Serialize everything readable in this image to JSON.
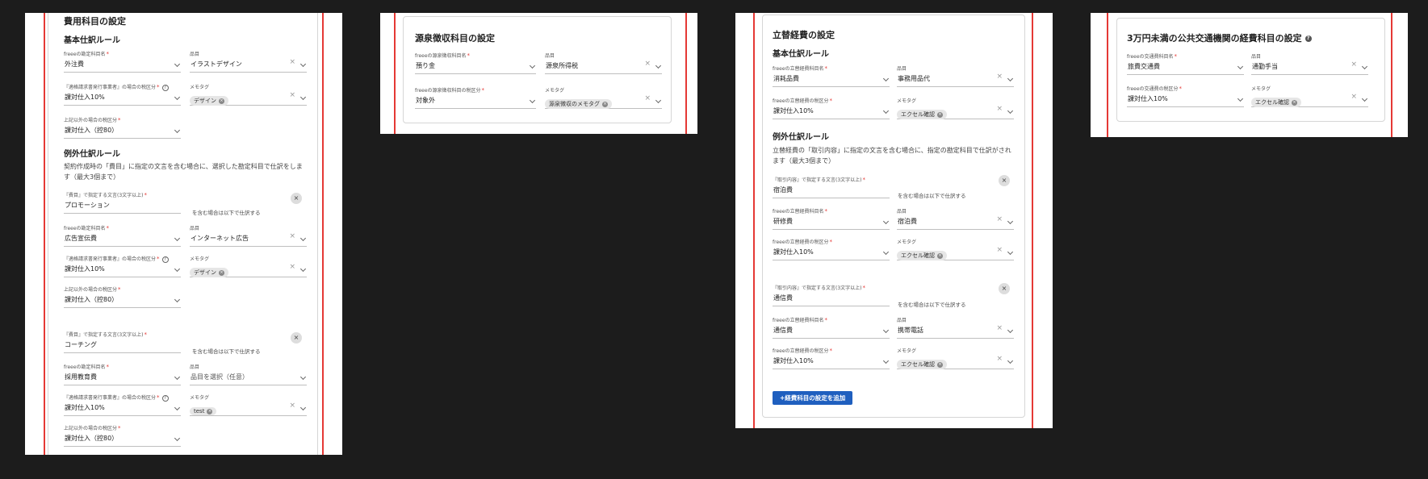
{
  "common": {
    "required_mark": "*",
    "help_mark": "?",
    "clear_mark": "×",
    "tag_remove_mark": "×",
    "remove_mark": "×"
  },
  "p1": {
    "title": "費用科目の設定",
    "basic_title": "基本仕訳ルール",
    "f_account_label": "freeeの勘定科目名",
    "f_account_value": "外注費",
    "f_item_label": "品目",
    "f_item_value": "イラストデザイン",
    "f_tax_label": "『適格請求書発行事業者』の場合の税区分",
    "f_tax_value": "課対仕入10%",
    "f_memo_label": "メモタグ",
    "f_memo_tag": "デザイン",
    "f_other_label": "上記以外の場合の税区分",
    "f_other_value": "課対仕入（控80）",
    "exc_title": "例外仕訳ルール",
    "exc_desc": "契約作成時の「費目」に指定の文言を含む場合に、選択した勘定科目で仕訳をします（最大3個まで）",
    "r1_text_label": "『費目』で指定する文言(3文字以上)",
    "r1_text_value": "プロモーション",
    "r1_note": "を含む場合は以下で仕訳する",
    "r1_account_label": "freeeの勘定科目名",
    "r1_account_value": "広告宣伝費",
    "r1_item_label": "品目",
    "r1_item_value": "インターネット広告",
    "r1_tax_label": "『適格請求書発行事業者』の場合の税区分",
    "r1_tax_value": "課対仕入10%",
    "r1_memo_label": "メモタグ",
    "r1_memo_tag": "デザイン",
    "r1_other_label": "上記以外の場合の税区分",
    "r1_other_value": "課対仕入（控80）",
    "r2_text_label": "『費目』で指定する文言(3文字以上)",
    "r2_text_value": "コーチング",
    "r2_note": "を含む場合は以下で仕訳する",
    "r2_account_label": "freeeの勘定科目名",
    "r2_account_value": "採用教育費",
    "r2_item_label": "品目",
    "r2_item_placeholder": "品目を選択（任意）",
    "r2_tax_label": "『適格請求書発行事業者』の場合の税区分",
    "r2_tax_value": "課対仕入10%",
    "r2_memo_label": "メモタグ",
    "r2_memo_tag": "test",
    "r2_other_label": "上記以外の場合の税区分",
    "r2_other_value": "課対仕入（控80）"
  },
  "p2": {
    "title": "源泉徴収科目の設定",
    "f_account_label": "freeeの源泉徴収科目名",
    "f_account_value": "預り金",
    "f_item_label": "品目",
    "f_item_value": "源泉所得税",
    "f_tax_label": "freeeの源泉徴収科目の税区分",
    "f_tax_value": "対象外",
    "f_memo_label": "メモタグ",
    "f_memo_tag": "源泉徴収のメモタグ"
  },
  "p3": {
    "title": "立替経費の設定",
    "basic_title": "基本仕訳ルール",
    "f_account_label": "freeeの立替経費科目名",
    "f_account_value": "消耗品費",
    "f_item_label": "品目",
    "f_item_value": "事務用品代",
    "f_tax_label": "freeeの立替経費の税区分",
    "f_tax_value": "課対仕入10%",
    "f_memo_label": "メモタグ",
    "f_memo_tag": "エクセル確認",
    "exc_title": "例外仕訳ルール",
    "exc_desc": "立替経費の「取引内容」に指定の文言を含む場合に、指定の勘定科目で仕訳がされます（最大3個まで）",
    "r1_text_label": "『取引内容』で指定する文言(3文字以上)",
    "r1_text_value": "宿泊費",
    "r1_note": "を含む場合は以下で仕訳する",
    "r1_account_label": "freeeの立替経費科目名",
    "r1_account_value": "研修費",
    "r1_item_label": "品目",
    "r1_item_value": "宿泊費",
    "r1_tax_label": "freeeの立替経費の税区分",
    "r1_tax_value": "課対仕入10%",
    "r1_memo_label": "メモタグ",
    "r1_memo_tag": "エクセル確認",
    "r2_text_label": "『取引内容』で指定する文言(3文字以上)",
    "r2_text_value": "通信費",
    "r2_note": "を含む場合は以下で仕訳する",
    "r2_account_label": "freeeの立替経費科目名",
    "r2_account_value": "通信費",
    "r2_item_label": "品目",
    "r2_item_value": "携帯電話",
    "r2_tax_label": "freeeの立替経費の税区分",
    "r2_tax_value": "課対仕入10%",
    "r2_memo_label": "メモタグ",
    "r2_memo_tag": "エクセル確認",
    "add_button": "+経費科目の設定を追加"
  },
  "p4": {
    "title": "3万円未満の公共交通機関の経費科目の設定",
    "f_account_label": "freeeの交通費科目名",
    "f_account_value": "旅費交通費",
    "f_item_label": "品目",
    "f_item_value": "通勤手当",
    "f_tax_label": "freeeの交通費の税区分",
    "f_tax_value": "課対仕入10%",
    "f_memo_label": "メモタグ",
    "f_memo_tag": "エクセル確認"
  }
}
